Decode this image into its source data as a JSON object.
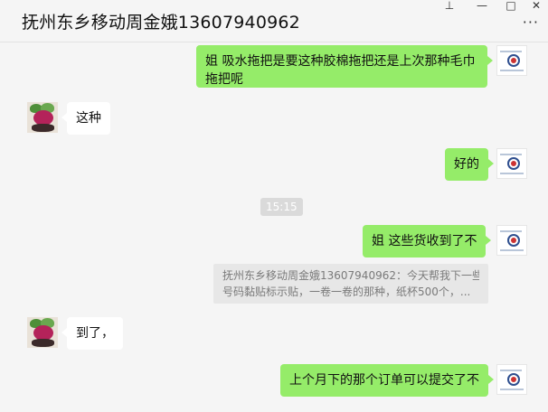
{
  "window": {
    "title": "抚州东乡移动周金娥13607940962",
    "controls": {
      "pin": "⊥",
      "minimize": "—",
      "maximize": "□",
      "close": "✕"
    },
    "more_label": "···"
  },
  "messages": [
    {
      "side": "me",
      "text": "姐  吸水拖把是要这种胶棉拖把还是上次那种毛巾拖把呢"
    },
    {
      "side": "other",
      "text": "这种"
    },
    {
      "side": "me",
      "text": "好的"
    },
    {
      "side": "time",
      "text": "15:15"
    },
    {
      "side": "me",
      "text": "姐 这些货收到了不"
    },
    {
      "side": "quote",
      "line1": "抚州东乡移动周金娥13607940962：今天帮我下一些",
      "line2": "号码黏贴标示贴，一卷一卷的那种，纸杯500个，..."
    },
    {
      "side": "other",
      "text": "到了，"
    },
    {
      "side": "me",
      "text": "上个月下的那个订单可以提交了不"
    }
  ]
}
